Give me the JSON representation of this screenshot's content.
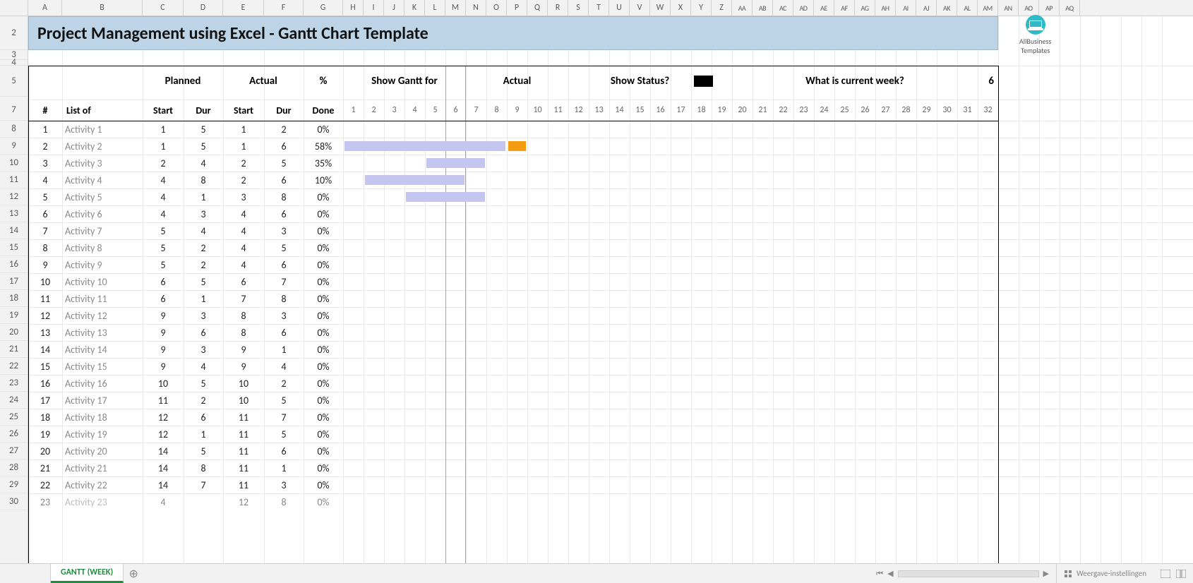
{
  "columns_letters": [
    "A",
    "B",
    "C",
    "D",
    "E",
    "F",
    "G",
    "H",
    "I",
    "J",
    "K",
    "L",
    "M",
    "N",
    "O",
    "P",
    "Q",
    "R",
    "S",
    "T",
    "U",
    "V",
    "W",
    "X",
    "Y",
    "Z",
    "AA",
    "AB",
    "AC",
    "AD",
    "AE",
    "AF",
    "AG",
    "AH",
    "AI",
    "AJ",
    "AK",
    "AL",
    "AM",
    "AN",
    "AO",
    "AP",
    "AQ"
  ],
  "row_numbers": [
    2,
    3,
    4,
    5,
    7,
    8,
    9,
    10,
    11,
    12,
    13,
    14,
    15,
    16,
    17,
    18,
    19,
    20,
    21,
    22,
    23,
    24,
    25,
    26,
    27,
    28,
    29,
    30
  ],
  "banner_title": "Project Management using Excel - Gantt Chart Template",
  "logo": {
    "line1": "AllBusiness",
    "line2": "Templates"
  },
  "headers": {
    "planned": "Planned",
    "actual": "Actual",
    "pct": "%",
    "show_gantt": "Show Gantt for",
    "actual2": "Actual",
    "show_status": "Show Status?",
    "current_week_q": "What is current week?",
    "current_week_val": "6",
    "num": "#",
    "list_of": "List of",
    "start": "Start",
    "dur": "Dur",
    "done": "Done"
  },
  "weeks": [
    1,
    2,
    3,
    4,
    5,
    6,
    7,
    8,
    9,
    10,
    11,
    12,
    13,
    14,
    15,
    16,
    17,
    18,
    19,
    20,
    21,
    22,
    23,
    24,
    25,
    26,
    27,
    28,
    29,
    30,
    31,
    32
  ],
  "current_week": 6,
  "rows": [
    {
      "n": 1,
      "name": "Activity 1",
      "ps": 1,
      "pd": 5,
      "as": 1,
      "ad": 2,
      "done": "0%"
    },
    {
      "n": 2,
      "name": "Activity 2",
      "ps": 1,
      "pd": 5,
      "as": 1,
      "ad": 6,
      "done": "58%"
    },
    {
      "n": 3,
      "name": "Activity 3",
      "ps": 2,
      "pd": 4,
      "as": 2,
      "ad": 5,
      "done": "35%"
    },
    {
      "n": 4,
      "name": "Activity 4",
      "ps": 4,
      "pd": 8,
      "as": 2,
      "ad": 6,
      "done": "10%"
    },
    {
      "n": 5,
      "name": "Activity 5",
      "ps": 4,
      "pd": 1,
      "as": 3,
      "ad": 8,
      "done": "0%"
    },
    {
      "n": 6,
      "name": "Activity 6",
      "ps": 4,
      "pd": 3,
      "as": 4,
      "ad": 6,
      "done": "0%"
    },
    {
      "n": 7,
      "name": "Activity 7",
      "ps": 5,
      "pd": 4,
      "as": 4,
      "ad": 3,
      "done": "0%"
    },
    {
      "n": 8,
      "name": "Activity 8",
      "ps": 5,
      "pd": 2,
      "as": 4,
      "ad": 5,
      "done": "0%"
    },
    {
      "n": 9,
      "name": "Activity 9",
      "ps": 5,
      "pd": 2,
      "as": 4,
      "ad": 6,
      "done": "0%"
    },
    {
      "n": 10,
      "name": "Activity 10",
      "ps": 6,
      "pd": 5,
      "as": 6,
      "ad": 7,
      "done": "0%"
    },
    {
      "n": 11,
      "name": "Activity 11",
      "ps": 6,
      "pd": 1,
      "as": 7,
      "ad": 8,
      "done": "0%"
    },
    {
      "n": 12,
      "name": "Activity 12",
      "ps": 9,
      "pd": 3,
      "as": 8,
      "ad": 3,
      "done": "0%"
    },
    {
      "n": 13,
      "name": "Activity 13",
      "ps": 9,
      "pd": 6,
      "as": 8,
      "ad": 6,
      "done": "0%"
    },
    {
      "n": 14,
      "name": "Activity 14",
      "ps": 9,
      "pd": 3,
      "as": 9,
      "ad": 1,
      "done": "0%"
    },
    {
      "n": 15,
      "name": "Activity 15",
      "ps": 9,
      "pd": 4,
      "as": 9,
      "ad": 4,
      "done": "0%"
    },
    {
      "n": 16,
      "name": "Activity 16",
      "ps": 10,
      "pd": 5,
      "as": 10,
      "ad": 2,
      "done": "0%"
    },
    {
      "n": 17,
      "name": "Activity 17",
      "ps": 11,
      "pd": 2,
      "as": 10,
      "ad": 5,
      "done": "0%"
    },
    {
      "n": 18,
      "name": "Activity 18",
      "ps": 12,
      "pd": 6,
      "as": 11,
      "ad": 7,
      "done": "0%"
    },
    {
      "n": 19,
      "name": "Activity 19",
      "ps": 12,
      "pd": 1,
      "as": 11,
      "ad": 5,
      "done": "0%"
    },
    {
      "n": 20,
      "name": "Activity 20",
      "ps": 14,
      "pd": 5,
      "as": 11,
      "ad": 6,
      "done": "0%"
    },
    {
      "n": 21,
      "name": "Activity 21",
      "ps": 14,
      "pd": 8,
      "as": 11,
      "ad": 1,
      "done": "0%"
    },
    {
      "n": 22,
      "name": "Activity 22",
      "ps": 14,
      "pd": 7,
      "as": 11,
      "ad": 3,
      "done": "0%"
    },
    {
      "n": 23,
      "name": "Activity 23",
      "ps": 4,
      "pd": "",
      "as": 12,
      "ad": 8,
      "done": "0%"
    }
  ],
  "gantt_bars": [
    {
      "row": 2,
      "start": 1,
      "end": 8,
      "cls": "light"
    },
    {
      "row": 2,
      "start": 9,
      "end": 9,
      "cls": "mark"
    },
    {
      "row": 3,
      "start": 5,
      "end": 7,
      "cls": "light"
    },
    {
      "row": 4,
      "start": 2,
      "end": 6,
      "cls": "light"
    },
    {
      "row": 5,
      "start": 4,
      "end": 7,
      "cls": "light"
    }
  ],
  "status_swatch": "#000",
  "tab": "GANTT (WEEK)",
  "footer_status": "Weergave-instellingen"
}
